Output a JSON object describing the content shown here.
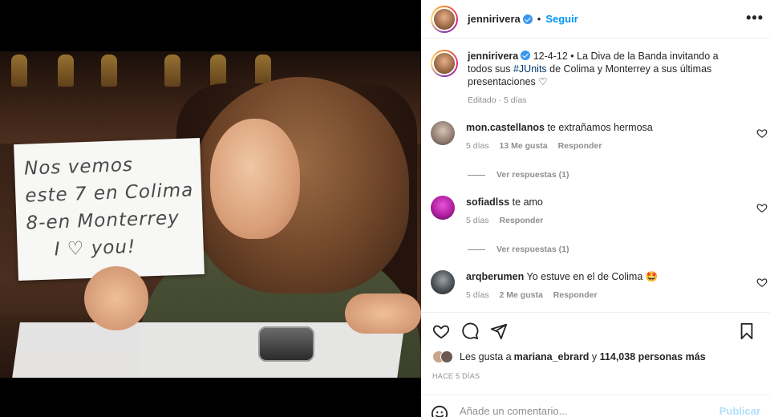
{
  "post": {
    "photo_sign_lines": [
      "Nos vemos",
      "este 7 en Colima",
      "8-en Monterrey",
      "I ♡ you!"
    ]
  },
  "header": {
    "username": "jennirivera",
    "separator": "•",
    "follow_label": "Seguir",
    "more_glyph": "•••"
  },
  "caption": {
    "username": "jennirivera",
    "text_before_tag": "12-4-12 • La Diva de la Banda invitando a todos sus ",
    "hashtag": "#JUnits",
    "text_after_tag": " de Colima y Monterrey a sus últimas presentaciones ♡",
    "meta": "Editado · 5 días"
  },
  "comments": [
    {
      "username": "mon.castellanos",
      "text": "te extrañamos hermosa",
      "time": "5 días",
      "likes": "13 Me gusta",
      "reply": "Responder",
      "replies": "Ver respuestas (1)",
      "avatar_color": "#8d7a70"
    },
    {
      "username": "sofiadlss",
      "text": "te amo",
      "time": "5 días",
      "likes": "",
      "reply": "Responder",
      "replies": "Ver respuestas (1)",
      "avatar_color": "#b01fa0"
    },
    {
      "username": "arqberumen",
      "text": "Yo estuve en el de Colima 🤩",
      "time": "5 días",
      "likes": "2 Me gusta",
      "reply": "Responder",
      "replies": "",
      "avatar_color": "#2b2b2b"
    }
  ],
  "likes_line": {
    "prefix": "Les gusta a ",
    "user": "mariana_ebrard",
    "middle": " y ",
    "count": "114,038 personas más"
  },
  "timestamp": "HACE 5 DÍAS",
  "composer": {
    "placeholder": "Añade un comentario...",
    "publish_label": "Publicar"
  },
  "colors": {
    "accent": "#0095f6",
    "muted": "#8e8e8e",
    "text": "#262626",
    "verified": "#3897f0"
  },
  "icons": [
    "verified-badge-icon",
    "more-options-icon",
    "heart-icon",
    "comment-icon",
    "share-icon",
    "bookmark-icon",
    "emoji-icon"
  ]
}
